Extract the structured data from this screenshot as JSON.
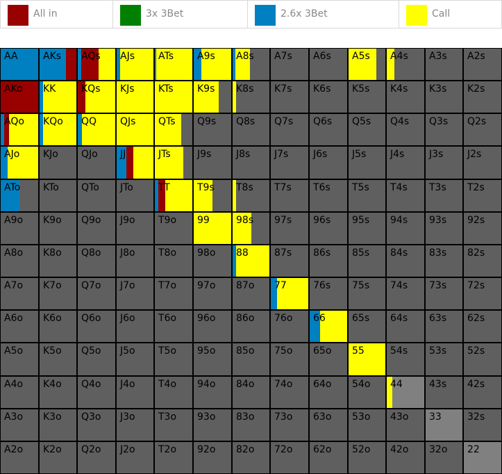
{
  "colors": {
    "all_in": "#990000",
    "threebet_3x": "#008000",
    "threebet_2_6x": "#0080c0",
    "call": "#ffff00",
    "fold": "#5f5f5f",
    "pair_fold": "#808080"
  },
  "legend": [
    {
      "label": "All in",
      "color": "#990000"
    },
    {
      "label": "3x 3Bet",
      "color": "#008000"
    },
    {
      "label": "2.6x 3Bet",
      "color": "#0080c0"
    },
    {
      "label": "Call",
      "color": "#ffff00"
    }
  ],
  "rows": [
    [
      "AA",
      "AKs",
      "AQs",
      "AJs",
      "ATs",
      "A9s",
      "A8s",
      "A7s",
      "A6s",
      "A5s",
      "A4s",
      "A3s",
      "A2s"
    ],
    [
      "AKo",
      "KK",
      "KQs",
      "KJs",
      "KTs",
      "K9s",
      "K8s",
      "K7s",
      "K6s",
      "K5s",
      "K4s",
      "K3s",
      "K2s"
    ],
    [
      "AQo",
      "KQo",
      "QQ",
      "QJs",
      "QTs",
      "Q9s",
      "Q8s",
      "Q7s",
      "Q6s",
      "Q5s",
      "Q4s",
      "Q3s",
      "Q2s"
    ],
    [
      "AJo",
      "KJo",
      "QJo",
      "JJ",
      "JTs",
      "J9s",
      "J8s",
      "J7s",
      "J6s",
      "J5s",
      "J4s",
      "J3s",
      "J2s"
    ],
    [
      "ATo",
      "KTo",
      "QTo",
      "JTo",
      "TT",
      "T9s",
      "T8s",
      "T7s",
      "T6s",
      "T5s",
      "T4s",
      "T3s",
      "T2s"
    ],
    [
      "A9o",
      "K9o",
      "Q9o",
      "J9o",
      "T9o",
      "99",
      "98s",
      "97s",
      "96s",
      "95s",
      "94s",
      "93s",
      "92s"
    ],
    [
      "A8o",
      "K8o",
      "Q8o",
      "J8o",
      "T8o",
      "98o",
      "88",
      "87s",
      "86s",
      "85s",
      "84s",
      "83s",
      "82s"
    ],
    [
      "A7o",
      "K7o",
      "Q7o",
      "J7o",
      "T7o",
      "97o",
      "87o",
      "77",
      "76s",
      "75s",
      "74s",
      "73s",
      "72s"
    ],
    [
      "A6o",
      "K6o",
      "Q6o",
      "J6o",
      "T6o",
      "96o",
      "86o",
      "76o",
      "66",
      "65s",
      "64s",
      "63s",
      "62s"
    ],
    [
      "A5o",
      "K5o",
      "Q5o",
      "J5o",
      "T5o",
      "95o",
      "85o",
      "75o",
      "65o",
      "55",
      "54s",
      "53s",
      "52s"
    ],
    [
      "A4o",
      "K4o",
      "Q4o",
      "J4o",
      "T4o",
      "94o",
      "84o",
      "74o",
      "64o",
      "54o",
      "44",
      "43s",
      "42s"
    ],
    [
      "A3o",
      "K3o",
      "Q3o",
      "J3o",
      "T3o",
      "93o",
      "83o",
      "73o",
      "63o",
      "53o",
      "43o",
      "33",
      "32s"
    ],
    [
      "A2o",
      "K2o",
      "Q2o",
      "J2o",
      "T2o",
      "92o",
      "82o",
      "72o",
      "62o",
      "52o",
      "42o",
      "32o",
      "22"
    ]
  ],
  "strategy": {
    "AA": {
      "blue": 1.0
    },
    "AKs": {
      "blue": 0.72,
      "red": 0.28
    },
    "AQs": {
      "blue": 0.09,
      "red": 0.47,
      "yellow": 0.44
    },
    "AJs": {
      "blue": 0.1,
      "yellow": 0.9
    },
    "ATs": {
      "blue": 0.04,
      "yellow": 0.96
    },
    "A9s": {
      "blue": 0.2,
      "yellow": 0.8
    },
    "A8s": {
      "blue": 0.07,
      "yellow": 0.4
    },
    "A5s": {
      "yellow": 0.75
    },
    "A4s": {
      "yellow": 0.2
    },
    "AKo": {
      "red": 1.0
    },
    "KK": {
      "blue": 0.1,
      "yellow": 0.9
    },
    "KQs": {
      "red": 0.2,
      "yellow": 0.8
    },
    "KJs": {
      "yellow": 1.0
    },
    "KTs": {
      "yellow": 1.0
    },
    "K9s": {
      "yellow": 0.66
    },
    "K8s": {
      "yellow": 0.1
    },
    "AQo": {
      "blue": 0.1,
      "red": 0.13,
      "yellow": 0.77
    },
    "KQo": {
      "blue": 0.1,
      "yellow": 0.9
    },
    "QQ": {
      "blue": 0.12,
      "yellow": 0.88
    },
    "QJs": {
      "yellow": 1.0
    },
    "QTs": {
      "yellow": 0.7
    },
    "AJo": {
      "blue": 0.18,
      "yellow": 0.82
    },
    "JJ": {
      "blue": 0.27,
      "red": 0.18,
      "yellow": 0.55
    },
    "JTs": {
      "yellow": 0.76
    },
    "ATo": {
      "blue": 0.5
    },
    "TT": {
      "blue": 0.1,
      "red": 0.17,
      "yellow": 0.73
    },
    "T9s": {
      "yellow": 0.5
    },
    "T8s": {
      "yellow": 0.1
    },
    "99": {
      "yellow": 1.0
    },
    "98s": {
      "yellow": 0.5
    },
    "88": {
      "blue": 0.1,
      "yellow": 0.9
    },
    "77": {
      "blue": 0.16,
      "yellow": 0.84
    },
    "66": {
      "blue": 0.27,
      "yellow": 0.73
    },
    "55": {
      "yellow": 1.0
    },
    "44": {
      "yellow": 0.15
    }
  }
}
